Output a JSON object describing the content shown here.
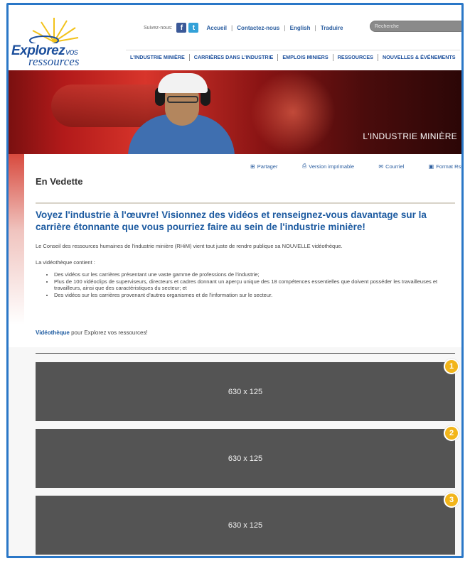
{
  "brand": {
    "name_main": "Explorez",
    "name_small": "vos",
    "name_second": "ressources"
  },
  "topbar": {
    "follow_label": "Suivez-nous:",
    "links": [
      "Accueil",
      "Contactez-nous",
      "English",
      "Traduire"
    ],
    "search_placeholder": "Recherche"
  },
  "nav": {
    "items": [
      "L'INDUSTRIE MINIÈRE",
      "CARRIÈRES DANS L'INDUSTRIE",
      "EMPLOIS MINIERS",
      "RESSOURCES",
      "NOUVELLES & ÉVÉNEMENTS"
    ]
  },
  "banner": {
    "title": "L'INDUSTRIE MINIÈRE"
  },
  "tools": {
    "share": "Partager",
    "print": "Version imprimable",
    "email": "Courriel",
    "rss": "Format Rss"
  },
  "content": {
    "section_title": "En Vedette",
    "headline": "Voyez l'industrie à l'œuvre! Visionnez des vidéos et renseignez-vous davantage sur la carrière étonnante que vous pourriez faire au sein de l'industrie minière!",
    "paragraph1": "Le Conseil des ressources humaines de l'industrie minière (RHiM) vient tout juste de rendre publique sa NOUVELLE vidéothèque.",
    "paragraph2": "La vidéothèque contient :",
    "list": [
      "Des vidéos sur les carrières présentant une vaste gamme de professions de l'industrie;",
      "Plus de 100 vidéoclips de superviseurs, directeurs et cadres donnant un aperçu unique des 18 compétences essentielles que doivent posséder les travailleuses et travailleurs, ainsi que des caractéristiques du secteur; et",
      "Des vidéos sur les carrières provenant d'autres organismes et de l'information sur le secteur."
    ],
    "video_link": "Vidéothèque",
    "video_suffix": " pour Explorez vos ressources!"
  },
  "slots": [
    {
      "label": "630 x 125",
      "badge": "1"
    },
    {
      "label": "630 x 125",
      "badge": "2"
    },
    {
      "label": "630 x 125",
      "badge": "3"
    }
  ],
  "colors": {
    "frame_border": "#2a77c7",
    "link_blue": "#1c5aa0",
    "badge": "#f2b51a",
    "slot_bg": "#545454"
  }
}
